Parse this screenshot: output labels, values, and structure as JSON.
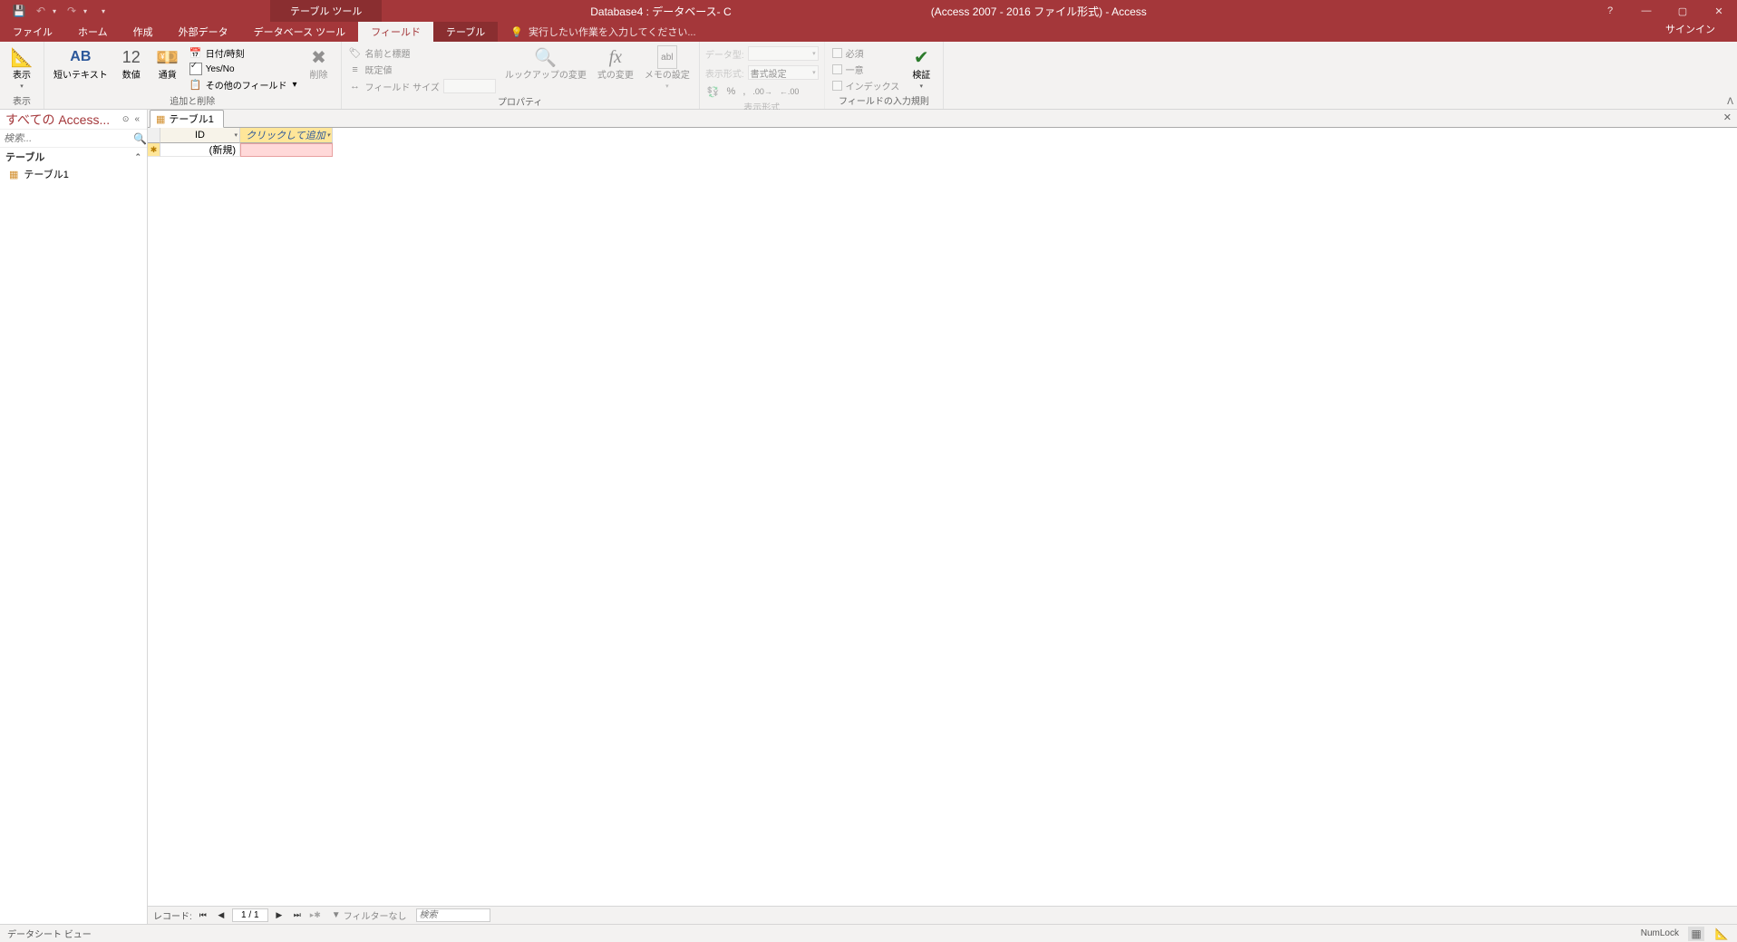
{
  "titlebar": {
    "table_tools": "テーブル ツール",
    "db_title": "Database4 : データベース- C",
    "format_title": "(Access 2007 - 2016 ファイル形式) - Access"
  },
  "tabs": {
    "file": "ファイル",
    "home": "ホーム",
    "create": "作成",
    "external": "外部データ",
    "dbtools": "データベース ツール",
    "fields": "フィールド",
    "table": "テーブル",
    "tellme": "実行したい作業を入力してください...",
    "signin": "サインイン"
  },
  "ribbon": {
    "view": {
      "label": "表示",
      "group": "表示"
    },
    "addremove": {
      "short_text": "短いテキスト",
      "number": "数値",
      "currency": "通貨",
      "datetime": "日付/時刻",
      "yesno": "Yes/No",
      "more": "その他のフィールド",
      "delete": "削除",
      "group": "追加と削除",
      "ab": "AB",
      "twelve": "12"
    },
    "properties": {
      "name_caption": "名前と標題",
      "default": "既定値",
      "field_size": "フィールド サイズ",
      "lookup": "ルックアップの変更",
      "expr": "式の変更",
      "memo": "メモの設定",
      "group": "プロパティ",
      "fx": "fx",
      "abl": "abl"
    },
    "formatting": {
      "datatype_lbl": "データ型:",
      "format_lbl": "表示形式:",
      "format_val": "書式設定",
      "group": "表示形式"
    },
    "validation": {
      "required": "必須",
      "unique": "一意",
      "indexed": "インデックス",
      "validate": "検証",
      "group": "フィールドの入力規則"
    }
  },
  "nav": {
    "header": "すべての Access...",
    "search_placeholder": "検索...",
    "group_tables": "テーブル",
    "item_table1": "テーブル1"
  },
  "doc": {
    "tab_name": "テーブル1",
    "col_id": "ID",
    "col_add": "クリックして追加",
    "new_row": "(新規)"
  },
  "recordnav": {
    "label": "レコード:",
    "position": "1 / 1",
    "no_filter": "フィルターなし",
    "search": "検索"
  },
  "status": {
    "view": "データシート ビュー",
    "numlock": "NumLock"
  }
}
